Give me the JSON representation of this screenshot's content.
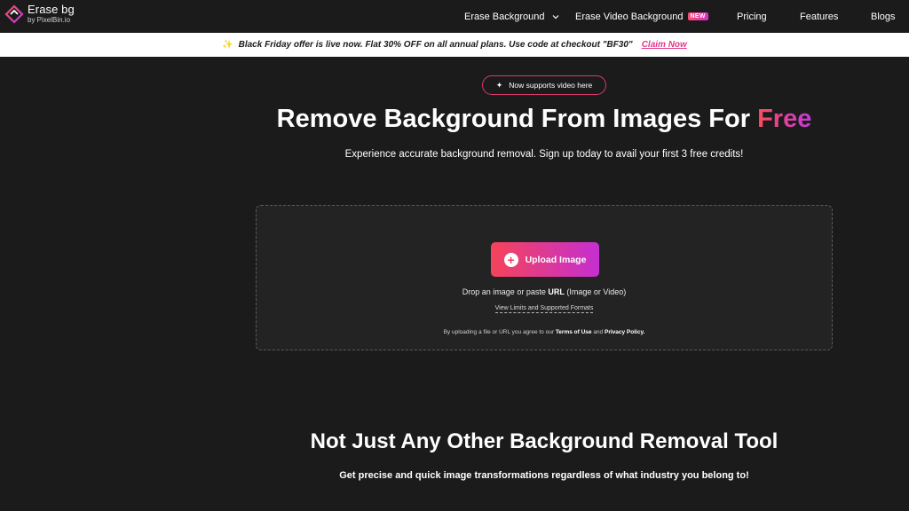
{
  "brand": {
    "name": "Erase bg",
    "sub": "by PixelBin.io",
    "accent_start": "#ff4b5c",
    "accent_end": "#c438d9",
    "background": "#1b1b1c"
  },
  "nav": {
    "items": [
      {
        "label": "Erase Background",
        "has_dropdown": true
      },
      {
        "label": "Erase Video Background",
        "badge": "NEW"
      },
      {
        "label": "Pricing"
      },
      {
        "label": "Features"
      },
      {
        "label": "Blogs"
      }
    ]
  },
  "promo": {
    "icon": "sparkle-icon",
    "text": "Black Friday offer is live now. Flat 30% OFF on all annual plans. Use code at checkout \"BF30\"",
    "link": "Claim Now"
  },
  "hero": {
    "pill": "Now supports video here",
    "title_main": "Remove Background From Images For ",
    "title_highlight": "Free",
    "subtitle": "Experience accurate background removal. Sign up today to avail your first 3 free credits!"
  },
  "upload": {
    "button": "Upload Image",
    "drop_prefix": "Drop an image or paste ",
    "drop_url": "URL",
    "drop_suffix": " (Image or Video)",
    "limits_link": "View Limits and Supported Formats",
    "terms_prefix": "By uploading a file or URL you agree to our ",
    "terms_link": "Terms of Use",
    "terms_and": " and ",
    "privacy_link": "Privacy Policy."
  },
  "section2": {
    "title": "Not Just Any Other Background Removal Tool",
    "subtitle": "Get precise and quick image transformations regardless of what industry you belong to!"
  }
}
